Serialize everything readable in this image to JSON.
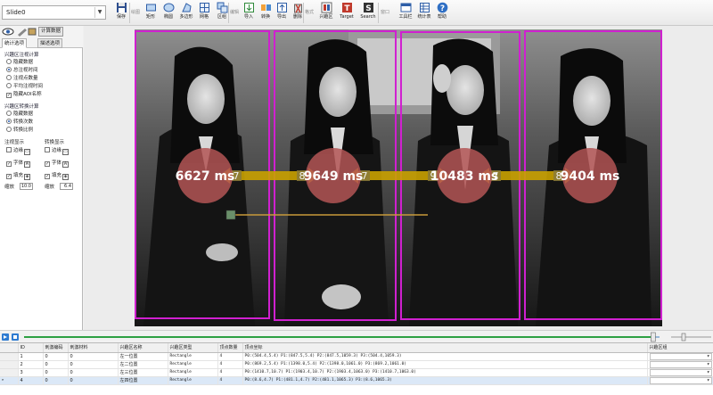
{
  "toolbar": {
    "slide_value": "Slide0",
    "buttons": [
      {
        "label": "保存",
        "icon": "save-icon"
      },
      {
        "label": "矩形",
        "icon": "rectangle-icon"
      },
      {
        "label": "椭圆",
        "icon": "ellipse-icon"
      },
      {
        "label": "多边形",
        "icon": "polygon-icon"
      },
      {
        "label": "网格",
        "icon": "grid-icon"
      },
      {
        "label": "区组",
        "icon": "group-icon"
      },
      {
        "label": "导入",
        "icon": "import-icon"
      },
      {
        "label": "转换",
        "icon": "convert-icon"
      },
      {
        "label": "导出",
        "icon": "export-icon"
      },
      {
        "label": "删除",
        "icon": "delete-icon"
      },
      {
        "label": "兴趣区",
        "icon": "aoi-icon"
      },
      {
        "label": "Target",
        "icon": "target-icon"
      },
      {
        "label": "Search",
        "icon": "search-icon"
      },
      {
        "label": "工具栏",
        "icon": "toolbar-icon"
      },
      {
        "label": "统计表",
        "icon": "stats-table-icon"
      },
      {
        "label": "帮助",
        "icon": "help-icon"
      }
    ],
    "groups": [
      "绘图",
      "编辑",
      "格式",
      "窗口"
    ]
  },
  "left_panel": {
    "calc_button": "计算数据",
    "tabs": [
      "统计选项",
      "描述选项"
    ],
    "stats_section": {
      "title": "兴趣区注视计算",
      "options": [
        {
          "label": "隐藏数据",
          "type": "radio",
          "checked": false
        },
        {
          "label": "总注视时间",
          "type": "radio",
          "checked": true
        },
        {
          "label": "注视点数量",
          "type": "radio",
          "checked": false
        },
        {
          "label": "平均注视时间",
          "type": "radio",
          "checked": false
        },
        {
          "label": "隐藏AOI名称",
          "type": "checkbox",
          "checked": true
        }
      ]
    },
    "transition_section": {
      "title": "兴趣区转换计算",
      "options": [
        {
          "label": "隐藏数据",
          "checked": false
        },
        {
          "label": "转换次数",
          "checked": true
        },
        {
          "label": "转换比例",
          "checked": false
        }
      ]
    },
    "display": {
      "aoi_title": "注视显示",
      "trans_title": "转换显示",
      "rows": [
        "边缘",
        "字体",
        "填充"
      ],
      "scale_label": "缩放",
      "scale_left": "10.0",
      "scale_right": "6.4"
    }
  },
  "canvas": {
    "aoi_values": [
      "6627 ms",
      "9649 ms",
      "10483 ms",
      "9404 ms"
    ],
    "transitions": [
      "7",
      "8",
      "7",
      "9",
      "7",
      "8"
    ],
    "colors": {
      "aoi_border": "#d020d0",
      "dwell_circle": "#b35555",
      "arrow": "#c9a100"
    }
  },
  "timeline": {
    "position": 0.99
  },
  "table": {
    "headers": [
      "ID",
      "刺激编码",
      "刺激材料",
      "兴趣区名称",
      "兴趣区类型",
      "顶点数量",
      "顶点坐标",
      "兴趣区组"
    ],
    "rows": [
      [
        "1",
        "0",
        "0",
        "左一位置",
        "Rectangle",
        "4",
        "P0:(504.4,5.4) P1:(847.5,5.4) P2:(847.5,1059.3) P3:(504.4,1059.3)"
      ],
      [
        "2",
        "0",
        "0",
        "左二位置",
        "Rectangle",
        "4",
        "P0:(869.2,5.4) P1:(1398.0,5.4) P2:(1398.0,1061.0) P3:(869.2,1061.0)"
      ],
      [
        "3",
        "0",
        "0",
        "左三位置",
        "Rectangle",
        "4",
        "P0:(1410.7,10.7) P1:(1903.4,10.7) P2:(1903.4,1063.0) P3:(1410.7,1063.0)"
      ],
      [
        "4",
        "0",
        "0",
        "左四位置",
        "Rectangle",
        "4",
        "P0:(8.6,4.7) P1:(481.1,4.7) P2:(481.1,1065.3) P3:(8.6,1065.3)"
      ]
    ]
  }
}
